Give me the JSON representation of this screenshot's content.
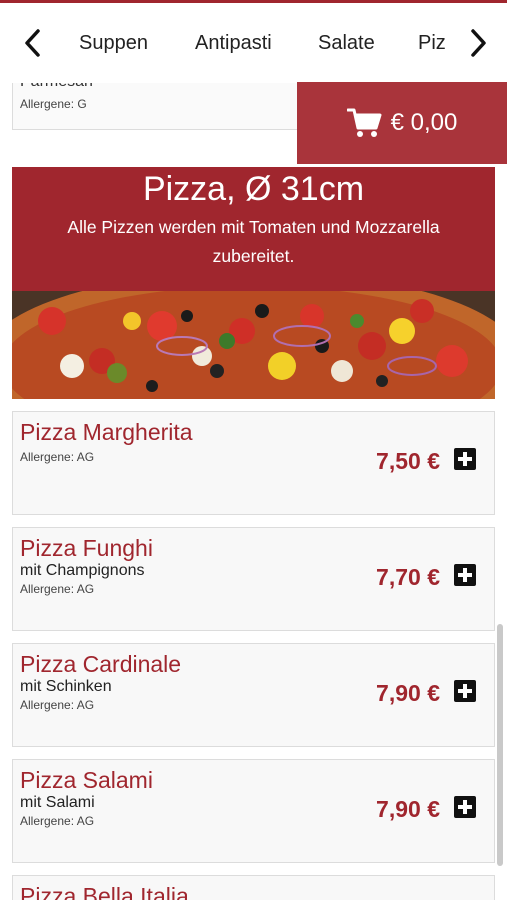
{
  "nav": {
    "tabs": [
      "Suppen",
      "Antipasti",
      "Salate",
      "Piz"
    ],
    "prev_icon": "chevron-left-icon",
    "next_icon": "chevron-right-icon"
  },
  "previous_item": {
    "title": "Parmesan",
    "allergens": "Allergene: G"
  },
  "cart": {
    "icon": "cart-icon",
    "amount": "€ 0,00"
  },
  "section": {
    "title": "Pizza, Ø 31cm",
    "description": "Alle Pizzen werden mit Tomaten und Mozzarella zubereitet."
  },
  "items": [
    {
      "title": "Pizza Margherita",
      "description": "",
      "allergens": "Allergene: AG",
      "price": "7,50 €"
    },
    {
      "title": "Pizza Funghi",
      "description": "mit Champignons",
      "allergens": "Allergene: AG",
      "price": "7,70 €"
    },
    {
      "title": "Pizza Cardinale",
      "description": "mit Schinken",
      "allergens": "Allergene: AG",
      "price": "7,90 €"
    },
    {
      "title": "Pizza Salami",
      "description": "mit Salami",
      "allergens": "Allergene: AG",
      "price": "7,90 €"
    },
    {
      "title": "Pizza Bella Italia",
      "description": "",
      "allergens": "",
      "price": ""
    }
  ],
  "colors": {
    "brand": "#a0262e",
    "cart_bg": "#a9343b"
  }
}
